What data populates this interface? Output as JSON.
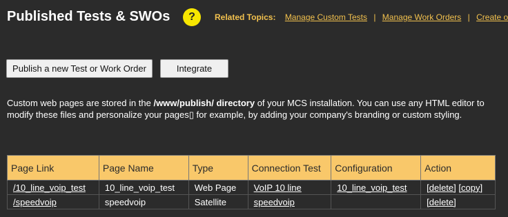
{
  "header": {
    "title": "Published Tests & SWOs",
    "help_symbol": "?",
    "related_label": "Related Topics:",
    "related_links": [
      "Manage Custom Tests",
      "Manage Work Orders",
      "Create or r"
    ],
    "separator": "|"
  },
  "toolbar": {
    "publish_label": "Publish a new Test or Work Order",
    "integrate_label": "Integrate"
  },
  "description": {
    "part1": "Custom web pages are stored in the ",
    "bold": "/www/publish/ directory",
    "part2": " of your MCS installation. You can use any HTML editor to modify these files and personalize your pages▯ for example, by adding your company's branding or custom styling."
  },
  "table": {
    "headers": [
      "Page Link",
      "Page Name",
      "Type",
      "Connection Test",
      "Configuration",
      "Action"
    ],
    "rows": [
      {
        "page_link": "/10_line_voip_test",
        "page_name": "10_line_voip_test",
        "type": "Web Page",
        "connection_test": "VoIP 10 line",
        "configuration": "10_line_voip_test",
        "actions": [
          "[delete]",
          "[copy]"
        ]
      },
      {
        "page_link": "/speedvoip",
        "page_name": "speedvoip",
        "type": "Satellite",
        "connection_test": "speedvoip",
        "configuration": "",
        "actions": [
          "[delete]"
        ]
      }
    ]
  },
  "colors": {
    "background": "#2b2b2b",
    "accent": "#f2c14e",
    "header_cell": "#f9c86a",
    "help_button": "#f7e600"
  },
  "icons": {
    "help": "help-icon"
  }
}
